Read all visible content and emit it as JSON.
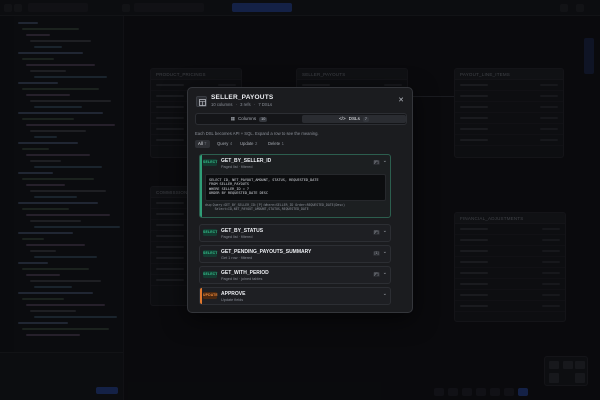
{
  "modal": {
    "title": "SELLER_PAYOUTS",
    "meta": {
      "columns": "10 columns",
      "refs": "3 refs",
      "dsls": "7 DSLs",
      "sep": "·"
    },
    "close_icon": "close-icon",
    "tabs": [
      {
        "label": "Columns",
        "count": "10",
        "icon": "table-icon"
      },
      {
        "label": "DSLs",
        "count": "7",
        "icon": "code-icon"
      }
    ],
    "description": "Each DSL becomes API + SQL. Expand a row to see the meaning.",
    "filters": [
      {
        "label": "All",
        "count": "7"
      },
      {
        "label": "Query",
        "count": "4"
      },
      {
        "label": "Update",
        "count": "2"
      },
      {
        "label": "Delete",
        "count": "1"
      }
    ],
    "dsls": [
      {
        "badge": "SELECT",
        "name": "GET_BY_SELLER_ID",
        "sub": "Paged list · filtered",
        "tag": "[P]",
        "code": [
          "SELECT ID, NET_PAYOUT_AMOUNT, STATUS, REQUESTED_DATE",
          "FROM SELLER_PAYOUTS",
          "WHERE SELLER_ID = ?",
          "ORDER BY REQUESTED_DATE DESC"
        ],
        "url": [
          "dsq:Query:GET_BY_SELLER_ID:[P]:Where=SELLER_ID Order=REQUESTED_DATE(Desc)",
          "     Select=ID,NET_PAYOUT_AMOUNT,STATUS,REQUESTED_DATE"
        ]
      },
      {
        "badge": "SELECT",
        "name": "GET_BY_STATUS",
        "sub": "Paged list · filtered",
        "tag": "[P]"
      },
      {
        "badge": "SELECT",
        "name": "GET_PENDING_PAYOUTS_SUMMARY",
        "sub": "Get 1 row · filtered",
        "tag": "[1]"
      },
      {
        "badge": "SELECT",
        "name": "GET_WITH_PERIOD",
        "sub": "Paged list · joined tables",
        "tag": "[P]"
      },
      {
        "badge": "UPDATE",
        "name": "APPROVE",
        "sub": "Update fields",
        "tag": ""
      }
    ]
  },
  "background": {
    "tables": [
      {
        "title": "PRODUCT_PRICINGS"
      },
      {
        "title": "SELLER_PAYOUTS"
      },
      {
        "title": "PAYOUT_LINE_ITEMS"
      },
      {
        "title": "COMMISSIONS"
      },
      {
        "title": "FINANCIAL_ADJUSTMENTS"
      }
    ]
  },
  "colors": {
    "select_badge": "#36c48f",
    "update_badge": "#f08a3c",
    "accent": "#2c4ea8"
  }
}
